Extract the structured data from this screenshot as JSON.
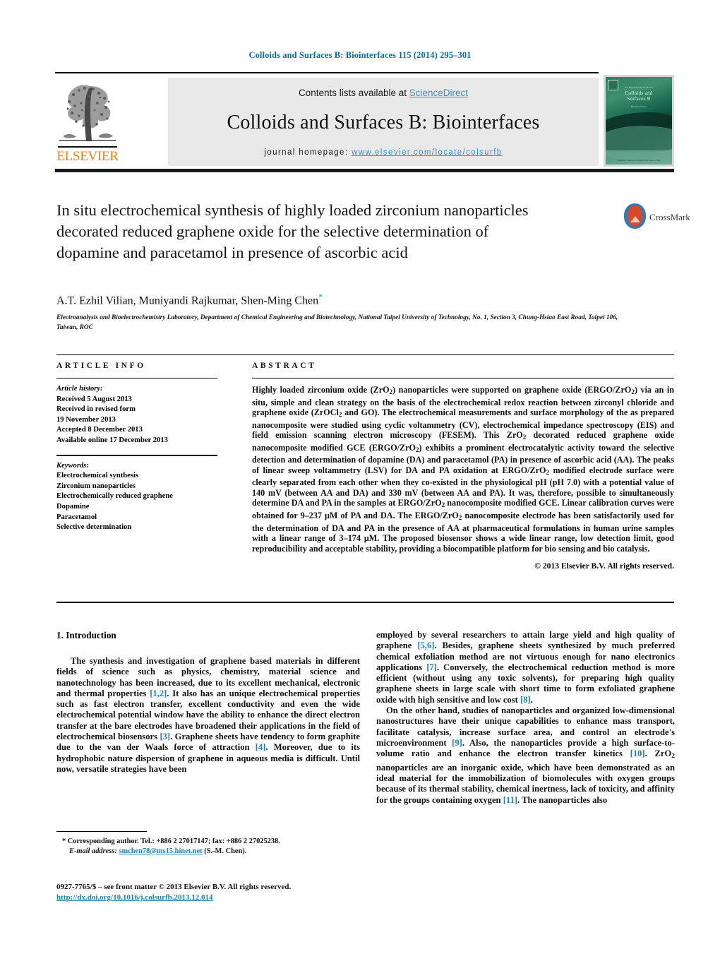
{
  "running_head": "Colloids and Surfaces B: Biointerfaces 115 (2014) 295–301",
  "masthead": {
    "contents_prefix": "Contents lists available at ",
    "sciencedirect": "ScienceDirect",
    "journal_title": "Colloids and Surfaces B: Biointerfaces",
    "homepage_prefix": "journal homepage: ",
    "homepage_url": "www.elsevier.com/locate/colsurfb",
    "publisher_wordmark": "ELSEVIER",
    "cover": {
      "line1": "Colloids and",
      "line2": "Surfaces B",
      "kicker": "An International Journal",
      "sub": "Biointerfaces",
      "footer": "Available online at www.sciencedirect.com"
    },
    "colors": {
      "link": "#3b8fc4",
      "banner_bg": "#e9e9e9",
      "elsevier_orange": "#f08010",
      "cover_green": "#2f7f63"
    }
  },
  "article": {
    "title": "In situ electrochemical synthesis of highly loaded zirconium nanoparticles decorated reduced graphene oxide for the selective determination of dopamine and paracetamol in presence of ascorbic acid",
    "authors": "A.T. Ezhil Vilian, Muniyandi Rajkumar, Shen-Ming Chen",
    "author_star": "*",
    "affiliation": "Electroanalysis and Bioelectrochemistry Laboratory, Department of Chemical Engineering and Biotechnology, National Taipei University of Technology, No. 1, Section 3, Chung-Hsiao East Road, Taipei 106, Taiwan, ROC",
    "crossmark_label": "CrossMark"
  },
  "article_info": {
    "heading": "ARTICLE INFO",
    "history_label": "Article history:",
    "history": [
      "Received 5 August 2013",
      "Received in revised form",
      "19 November 2013",
      "Accepted 8 December 2013",
      "Available online 17 December 2013"
    ],
    "keywords_label": "Keywords:",
    "keywords": [
      "Electrochemical synthesis",
      "Zirconium nanoparticles",
      "Electrochemically reduced graphene",
      "Dopamine",
      "Paracetamol",
      "Selective determination"
    ]
  },
  "abstract": {
    "heading": "ABSTRACT",
    "paragraph_html": "Highly loaded zirconium oxide (ZrO<sub>2</sub>) nanoparticles were supported on graphene oxide (ERGO/ZrO<sub>2</sub>) via an in situ, simple and clean strategy on the basis of the electrochemical redox reaction between zirconyl chloride and graphene oxide (ZrOCl<sub>2</sub> and GO). The electrochemical measurements and surface morphology of the as prepared nanocomposite were studied using cyclic voltammetry (CV), electrochemical impedance spectroscopy (EIS) and field emission scanning electron microscopy (FESEM). This ZrO<sub>2</sub> decorated reduced graphene oxide nanocomposite modified GCE (ERGO/ZrO<sub>2</sub>) exhibits a prominent electrocatalytic activity toward the selective detection and determination of dopamine (DA) and paracetamol (PA) in presence of ascorbic acid (AA). The peaks of linear sweep voltammetry (LSV) for DA and PA oxidation at ERGO/ZrO<sub>2</sub> modified electrode surface were clearly separated from each other when they co-existed in the physiological pH (pH 7.0) with a potential value of 140 mV (between AA and DA) and 330 mV (between AA and PA). It was, therefore, possible to simultaneously determine DA and PA in the samples at ERGO/ZrO<sub>2</sub> nanocomposite modified GCE. Linear calibration curves were obtained for 9–237 &mu;M of PA and DA. The ERGO/ZrO<sub>2</sub> nanocomposite electrode has been satisfactorily used for the determination of DA and PA in the presence of AA at pharmaceutical formulations in human urine samples with a linear range of 3–174 &mu;M. The proposed biosensor shows a wide linear range, low detection limit, good reproducibility and acceptable stability, providing a biocompatible platform for bio sensing and bio catalysis.",
    "copyright": "© 2013 Elsevier B.V. All rights reserved."
  },
  "introduction": {
    "section_title": "1.  Introduction",
    "left_paragraph_1_html": "The synthesis and investigation of graphene based materials in different fields of science such as physics, chemistry, material science and nanotechnology has been increased, due to its excellent mechanical, electronic and thermal properties <span class=\"ref\">[1,2]</span>. It also has an unique electrochemical properties such as fast electron transfer, excellent conductivity and even the wide electrochemical potential window have the ability to enhance the direct electron transfer at the bare electrodes have broadened their applications in the field of electrochemical biosensors <span class=\"ref\">[3]</span>. Graphene sheets have tendency to form graphite due to the van der Waals force of attraction <span class=\"ref\">[4]</span>. Moreover, due to its hydrophobic nature dispersion of graphene in aqueous media is difficult. Until now, versatile strategies have been",
    "right_paragraph_1_html": "employed by several researchers to attain large yield and high quality of graphene <span class=\"ref\">[5,6]</span>. Besides, graphene sheets synthesized by much preferred chemical exfoliation method are not virtuous enough for nano electronics applications <span class=\"ref\">[7]</span>. Conversely, the electrochemical reduction method is more efficient (without using any toxic solvents), for preparing high quality graphene sheets in large scale with short time to form exfoliated graphene oxide with high sensitive and low cost <span class=\"ref\">[8]</span>.",
    "right_paragraph_2_html": "On the other hand, studies of nanoparticles and organized low-dimensional nanostructures have their unique capabilities to enhance mass transport, facilitate catalysis, increase surface area, and control an electrode's microenvironment <span class=\"ref\">[9]</span>. Also, the nanoparticles provide a high surface-to-volume ratio and enhance the electron transfer kinetics <span class=\"ref\">[10]</span>. ZrO<sub>2</sub> nanoparticles are an inorganic oxide, which have been demonstrated as an ideal material for the immobilization of biomolecules with oxygen groups because of its thermal stability, chemical inertness, lack of toxicity, and affinity for the groups containing oxygen <span class=\"ref\">[11]</span>. The nanoparticles also"
  },
  "footnote": {
    "corresponding_html": "<span style=\"font-weight:bold\">*</span>  Corresponding author. Tel.: +886 2 27017147; fax: +886 2 27025238.",
    "email_label": "E-mail address:",
    "email": "smchen78@ms15.hinet.net",
    "email_suffix": "(S.-M. Chen).",
    "issn_line": "0927-7765/$ – see front matter © 2013 Elsevier B.V. All rights reserved.",
    "doi": "http://dx.doi.org/10.1016/j.colsurfb.2013.12.014"
  }
}
